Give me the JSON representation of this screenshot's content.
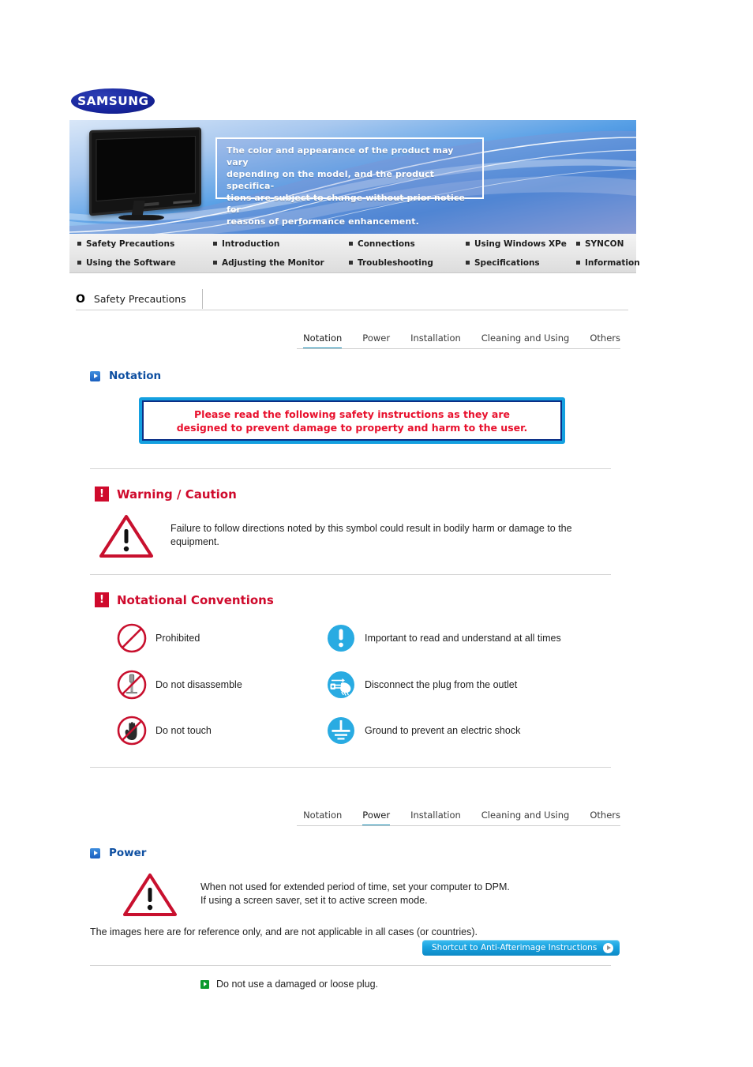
{
  "brand": {
    "logo_text": "SAMSUNG"
  },
  "banner": {
    "notice_lines": [
      "The color and appearance of the product may vary",
      "depending on the model, and the product specifica-",
      "tions are subject to change without prior notice for",
      "reasons of performance enhancement."
    ]
  },
  "nav": {
    "row1": [
      "Safety Precautions",
      "Introduction",
      "Connections",
      "Using Windows XPe",
      "SYNCON"
    ],
    "row2": [
      "Using the Software",
      "Adjusting the Monitor",
      "Troubleshooting",
      "Specifications",
      "Information"
    ]
  },
  "section": {
    "icon": "circle-o-icon",
    "title": "Safety Precautions"
  },
  "tabs_top": {
    "items": [
      "Notation",
      "Power",
      "Installation",
      "Cleaning and Using",
      "Others"
    ],
    "active": "Notation"
  },
  "tabs_bottom": {
    "items": [
      "Notation",
      "Power",
      "Installation",
      "Cleaning and Using",
      "Others"
    ],
    "active": "Power"
  },
  "notation": {
    "heading": "Notation",
    "notice_line1": "Please read the following safety instructions as they are",
    "notice_line2": "designed to prevent damage to property and harm to the user."
  },
  "warning": {
    "heading": "Warning / Caution",
    "bang": "!",
    "text": "Failure to follow directions noted by this symbol could result in bodily harm or damage to the equipment."
  },
  "conventions": {
    "heading": "Notational Conventions",
    "bang": "!",
    "left": [
      {
        "icon": "prohibited-icon",
        "label": "Prohibited"
      },
      {
        "icon": "do-not-disassemble-icon",
        "label": "Do not disassemble"
      },
      {
        "icon": "do-not-touch-icon",
        "label": "Do not touch"
      }
    ],
    "right": [
      {
        "icon": "important-exclamation-icon",
        "label": "Important to read and understand at all times"
      },
      {
        "icon": "disconnect-plug-icon",
        "label": "Disconnect the plug from the outlet"
      },
      {
        "icon": "ground-icon",
        "label": "Ground to prevent an electric shock"
      }
    ]
  },
  "power": {
    "heading": "Power",
    "line1": "When not used for extended period of time, set your computer to DPM.",
    "line2": "If using a screen saver, set it to active screen mode.",
    "reference_note": "The images here are for reference only, and are not applicable in all cases (or countries).",
    "shortcut_label": "Shortcut to Anti-Afterimage Instructions",
    "first_item": "Do not use a damaged or loose plug."
  },
  "colors": {
    "samsung_blue": "#1428a0",
    "heading_blue": "#0e4fa1",
    "alert_red": "#cf0a2c",
    "notice_red": "#e8102d",
    "tab_active": "#1d8fb5",
    "cyan": "#14a0e0",
    "green": "#0a9a2e",
    "icon_blue": "#29abe2",
    "prohibit_red": "#c8102e"
  }
}
